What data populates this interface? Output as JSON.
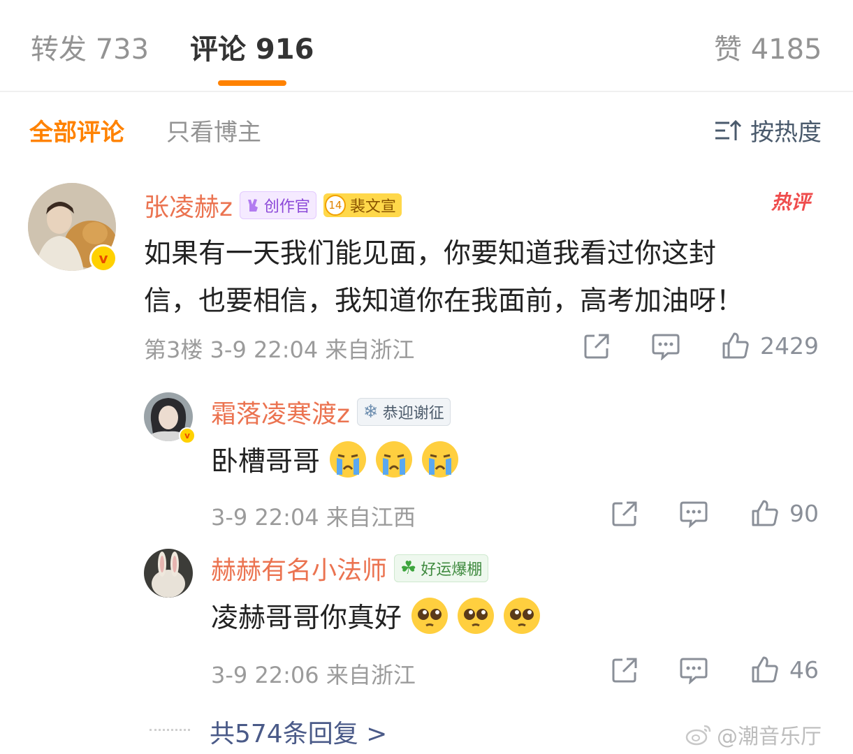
{
  "tabs": {
    "repost": "转发 733",
    "comment": "评论 916",
    "like": "赞 4185"
  },
  "filters": {
    "all": "全部评论",
    "author_only": "只看博主",
    "sort": "按热度"
  },
  "colors": {
    "accent": "#ff8200",
    "name": "#eb7350"
  },
  "main_comment": {
    "username": "张凌赫z",
    "badge_creator": "创作官",
    "badge_fan_level": "14",
    "badge_fan_name": "裴文宣",
    "hot_label": "热评",
    "text_line1": "如果有一天我们能见面，你要知道我看过你这封",
    "text_line2": "信，也要相信，我知道你在我面前，高考加油呀！",
    "meta": "第3楼 3-9 22:04 来自浙江",
    "likes": "2429",
    "icons": [
      "share-icon",
      "comment-icon",
      "like-icon"
    ]
  },
  "replies": [
    {
      "username": "霜落凌寒渡z",
      "badge": "恭迎谢征",
      "badge_icon": "snowflake-icon",
      "text": "卧槽哥哥",
      "emoji": "crying-face-emoji",
      "meta": "3-9 22:04 来自江西",
      "likes": "90"
    },
    {
      "username": "赫赫有名小法师",
      "badge": "好运爆棚",
      "badge_icon": "clover-icon",
      "text": "凌赫哥哥你真好",
      "emoji": "pleading-face-emoji",
      "meta": "3-9 22:06 来自浙江",
      "likes": "46"
    }
  ],
  "more_replies": "共574条回复 >",
  "watermark": "@潮音乐厅"
}
